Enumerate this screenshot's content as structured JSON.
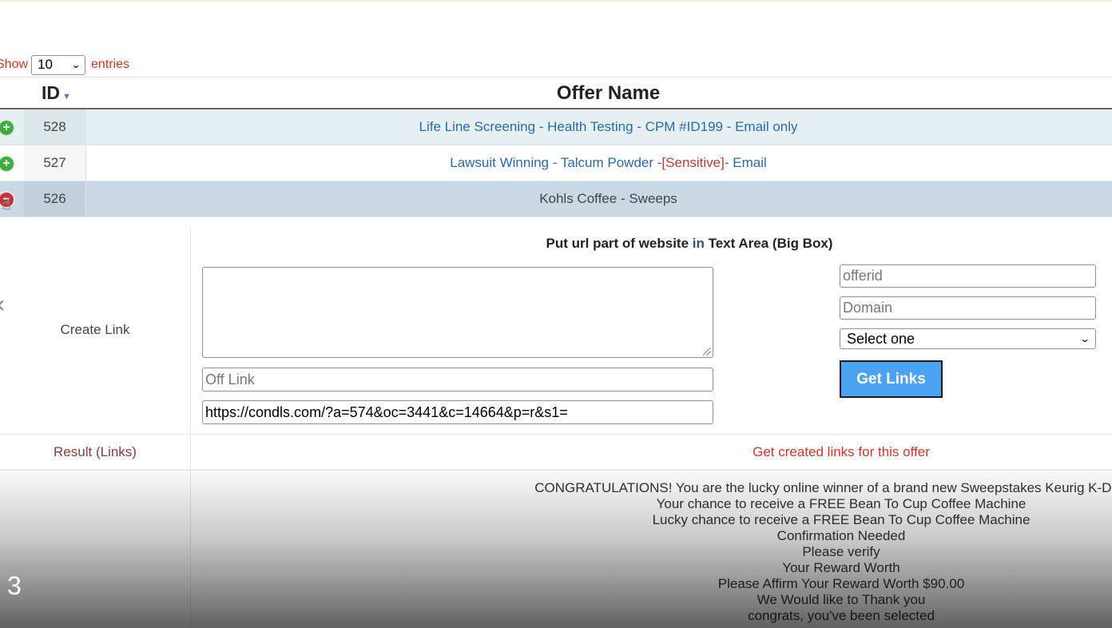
{
  "show_entries": {
    "show_label": "Show",
    "selected": "10",
    "entries_label": "entries"
  },
  "table": {
    "id_header": "ID",
    "name_header": "Offer Name",
    "rows": [
      {
        "id": "528",
        "name_parts": [
          "Life Line Screening - Health Testing - CPM #ID199 - Email only"
        ],
        "state": "collapsed"
      },
      {
        "id": "527",
        "name_parts": [
          "Lawsuit Winning - Talcum Powder - ",
          "[Sensitive]",
          " - Email"
        ],
        "state": "collapsed"
      },
      {
        "id": "526",
        "name_parts": [
          "Kohls Coffee - Sweeps"
        ],
        "state": "expanded"
      }
    ]
  },
  "detail": {
    "create_link_label": "Create Link",
    "instruction_part1": "Put url part of website ",
    "instruction_part2": "in",
    "instruction_part3": " Text Area (Big Box)",
    "big_box_value": "",
    "off_link_placeholder": "Off Link",
    "url_value": "https://condls.com/?a=574&oc=3441&c=14664&p=r&s1=",
    "offerid_placeholder": "offerid",
    "domain_placeholder": "Domain",
    "select_value": "Select one",
    "get_links_label": "Get Links",
    "result_label": "Result (Links)",
    "result_text": "Get created links for this offer",
    "subject_lines": [
      "CONGRATULATIONS! You are the lucky online winner of a brand new Sweepstakes Keurig K-Duo Co",
      "Your chance to receive a FREE Bean To Cup Coffee Machine",
      "Lucky chance to receive a FREE Bean To Cup Coffee Machine",
      "Confirmation Needed",
      "Please verify",
      "Your Reward Worth",
      "Please Affirm Your Reward Worth $90.00",
      "We Would like to Thank you",
      "congrats, you've been selected"
    ]
  },
  "overlay": {
    "slide_number": "3"
  },
  "colors": {
    "link_red": "#d93025",
    "row_odd": "#e6f0f3",
    "row_selected": "#c9d8e3",
    "button_blue": "#4aa3f2",
    "plus_green": "#3cae3c",
    "minus_red": "#c8323a"
  },
  "icons": {
    "expand": "plus-circle-icon",
    "collapse": "minus-circle-icon",
    "cursor": "hand-pointer-icon",
    "sort": "sort-desc-icon",
    "prev": "chevron-left-icon"
  }
}
